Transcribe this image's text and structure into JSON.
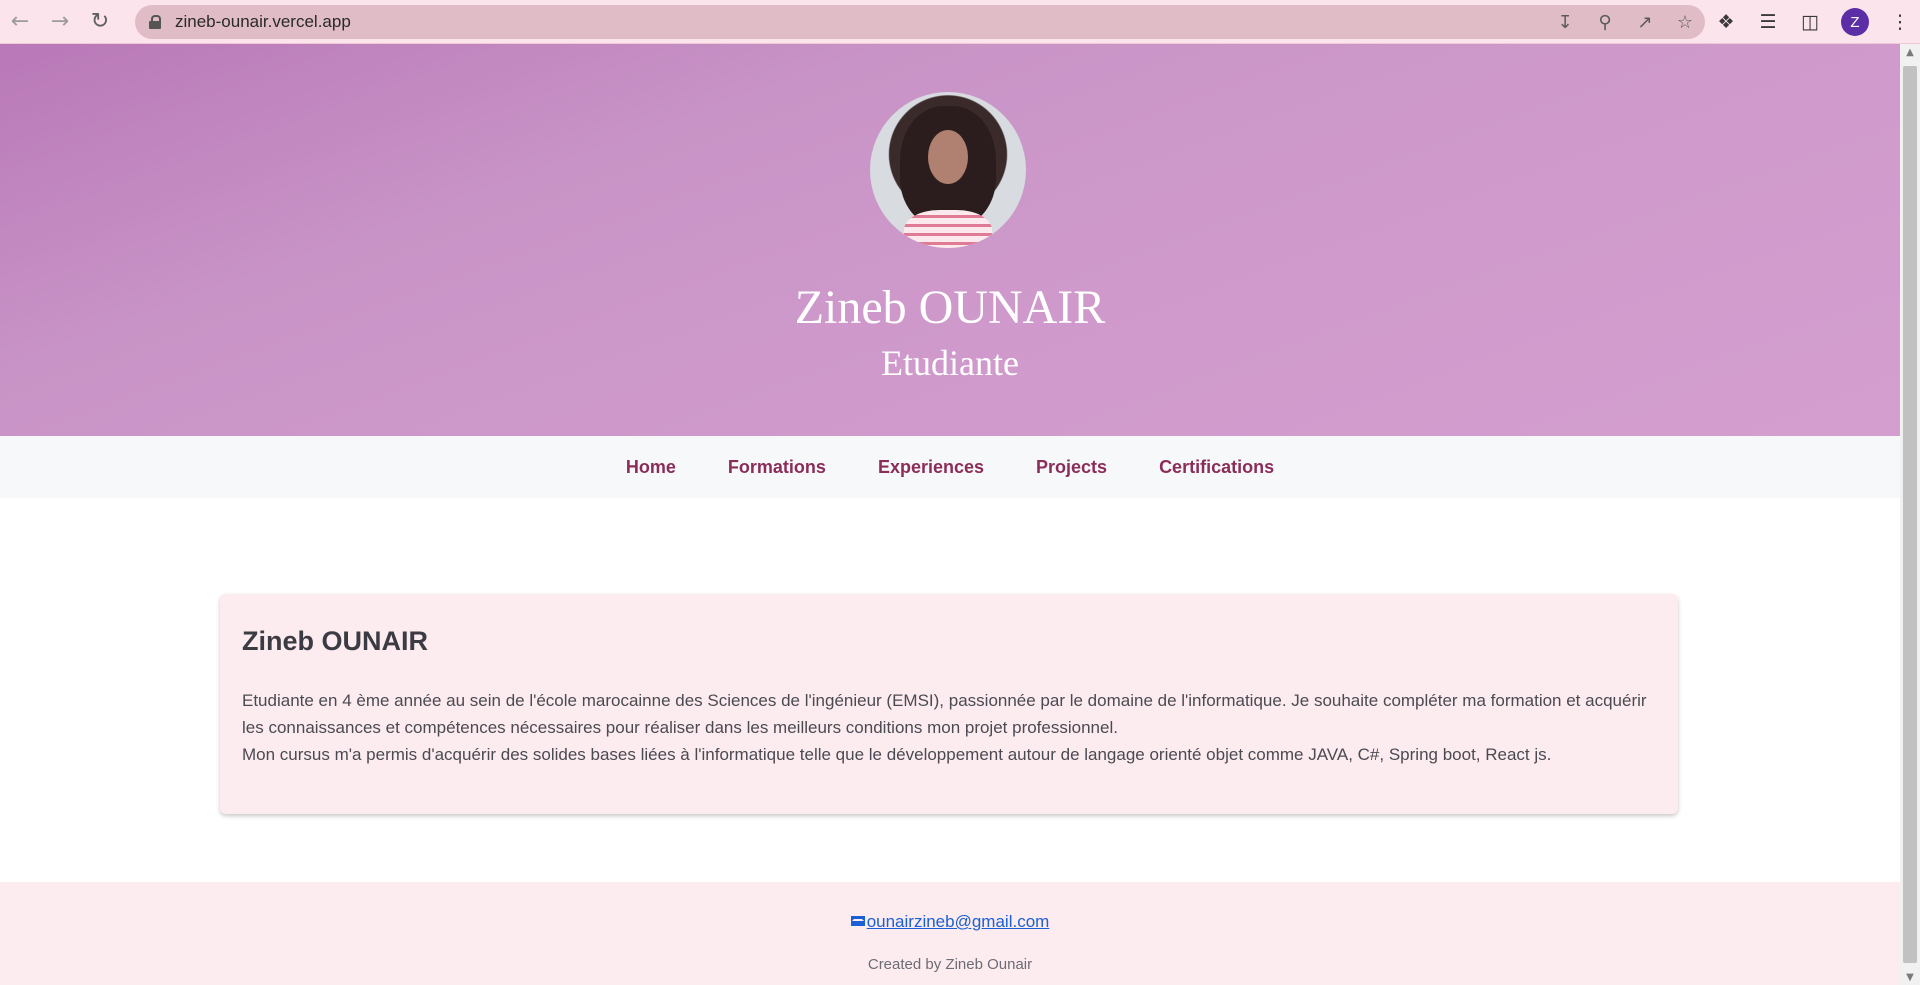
{
  "browser": {
    "url": "zineb-ounair.vercel.app",
    "profile_initial": "Z",
    "nav_icons": [
      "back-arrow-icon",
      "forward-arrow-icon",
      "reload-icon"
    ],
    "omnibox_icons": [
      "install-app-icon",
      "zoom-icon",
      "share-icon",
      "bookmark-star-icon"
    ],
    "toolbar_icons": [
      "extensions-puzzle-icon",
      "media-playlist-icon",
      "side-panel-icon",
      "menu-kebab-icon"
    ]
  },
  "hero": {
    "name": "Zineb OUNAIR",
    "role": "Etudiante"
  },
  "menu": {
    "items": [
      {
        "label": "Home"
      },
      {
        "label": "Formations"
      },
      {
        "label": "Experiences"
      },
      {
        "label": "Projects"
      },
      {
        "label": "Certifications"
      }
    ]
  },
  "about": {
    "title": "Zineb OUNAIR",
    "line1": "Etudiante en 4 ème année au sein de l'école marocainne des Sciences de l'ingénieur (EMSI), passionnée par le domaine de l'informatique. Je souhaite compléter ma formation et acquérir les connaissances et compétences nécessaires pour réaliser dans les meilleurs conditions mon projet professionnel.",
    "line2": "Mon cursus m'a permis d'acquérir des solides bases liées à l'informatique telle que le développement autour de langage orienté objet comme JAVA, C#, Spring boot, React js."
  },
  "footer": {
    "email": "ounairzineb@gmail.com",
    "credit": "Created by Zineb Ounair"
  },
  "colors": {
    "hero_gradient_start": "#b978b8",
    "hero_gradient_end": "#d49fcf",
    "menu_link": "#8a2d59",
    "card_bg": "#fdecef",
    "link": "#1a5fd6"
  }
}
